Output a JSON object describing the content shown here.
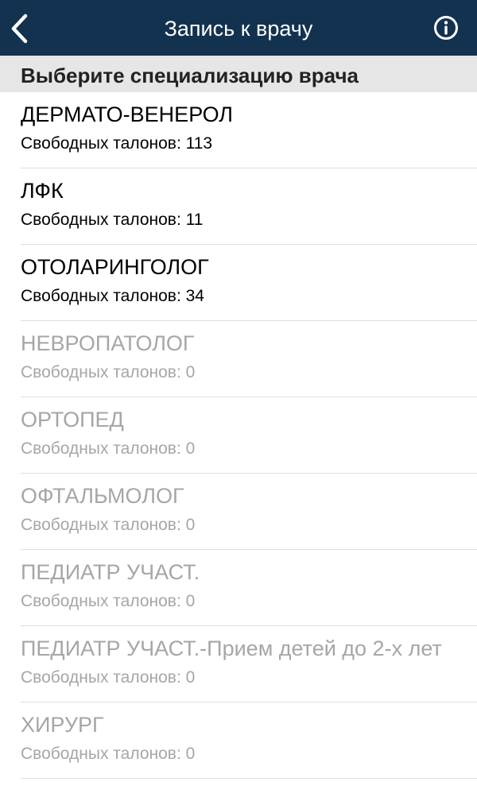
{
  "navbar": {
    "title": "Запись к врачу",
    "back_icon": "chevron-left-icon",
    "info_icon": "info-circle-icon",
    "background_color": "#13324f"
  },
  "section": {
    "header": "Выберите специализацию врача"
  },
  "specialties": [
    {
      "name": "ДЕРМАТО-ВЕНЕРОЛ",
      "count_text": "Свободных талонов: 113",
      "available": true
    },
    {
      "name": "ЛФК",
      "count_text": "Свободных талонов: 11",
      "available": true
    },
    {
      "name": "ОТОЛАРИНГОЛОГ",
      "count_text": "Свободных талонов: 34",
      "available": true
    },
    {
      "name": "НЕВРОПАТОЛОГ",
      "count_text": "Свободных талонов: 0",
      "available": false
    },
    {
      "name": "ОРТОПЕД",
      "count_text": "Свободных талонов: 0",
      "available": false
    },
    {
      "name": "ОФТАЛЬМОЛОГ",
      "count_text": "Свободных талонов: 0",
      "available": false
    },
    {
      "name": "ПЕДИАТР УЧАСТ.",
      "count_text": "Свободных талонов: 0",
      "available": false
    },
    {
      "name": "ПЕДИАТР УЧАСТ.-Прием детей до 2-х лет",
      "count_text": "Свободных талонов: 0",
      "available": false
    },
    {
      "name": "ХИРУРГ",
      "count_text": "Свободных талонов: 0",
      "available": false
    }
  ]
}
